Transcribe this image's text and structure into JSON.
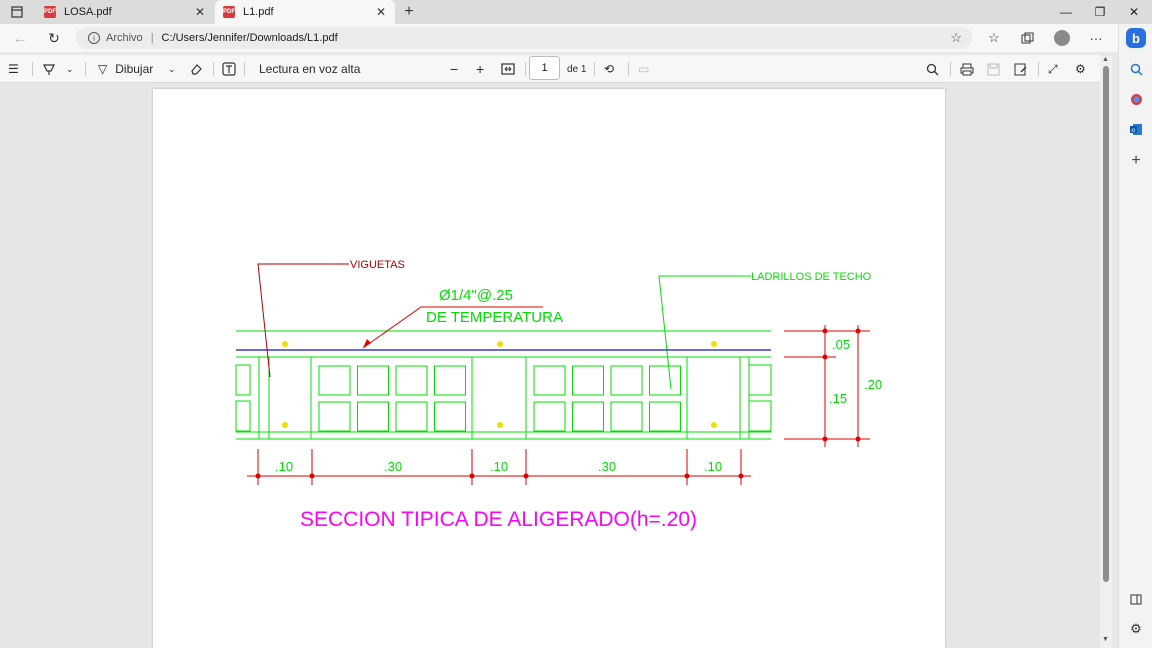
{
  "tabs": [
    {
      "title": "LOSA.pdf",
      "active": false
    },
    {
      "title": "L1.pdf",
      "active": true
    }
  ],
  "address": {
    "scheme_label": "Archivo",
    "url": "C:/Users/Jennifer/Downloads/L1.pdf"
  },
  "pdf_toolbar": {
    "draw_label": "Dibujar",
    "read_aloud_label": "Lectura en voz alta",
    "page_number": "1",
    "page_total": "de 1"
  },
  "drawing": {
    "label_viguetas": "VIGUETAS",
    "label_ladrillos": "LADRILLOS DE TECHO",
    "label_bar": "Ø1/4\"@.25",
    "label_temperatura": "DE TEMPERATURA",
    "dim_top": ".05",
    "dim_mid": ".15",
    "dim_total": ".20",
    "dims_bottom": [
      ".10",
      ".30",
      ".10",
      ".30",
      ".10"
    ],
    "title": "SECCION TIPICA DE ALIGERADO(h=.20)"
  },
  "colors": {
    "green": "#00e000",
    "red": "#e00000",
    "dark_red": "#b00000",
    "blue": "#3a3ad0",
    "yellow": "#f0e000",
    "magenta": "#ff00ff"
  },
  "icons": {
    "sidebar": [
      "bing-copilot-icon",
      "search-icon",
      "office-icon",
      "outlook-icon",
      "add-icon",
      "split-screen-icon",
      "settings-icon"
    ]
  }
}
